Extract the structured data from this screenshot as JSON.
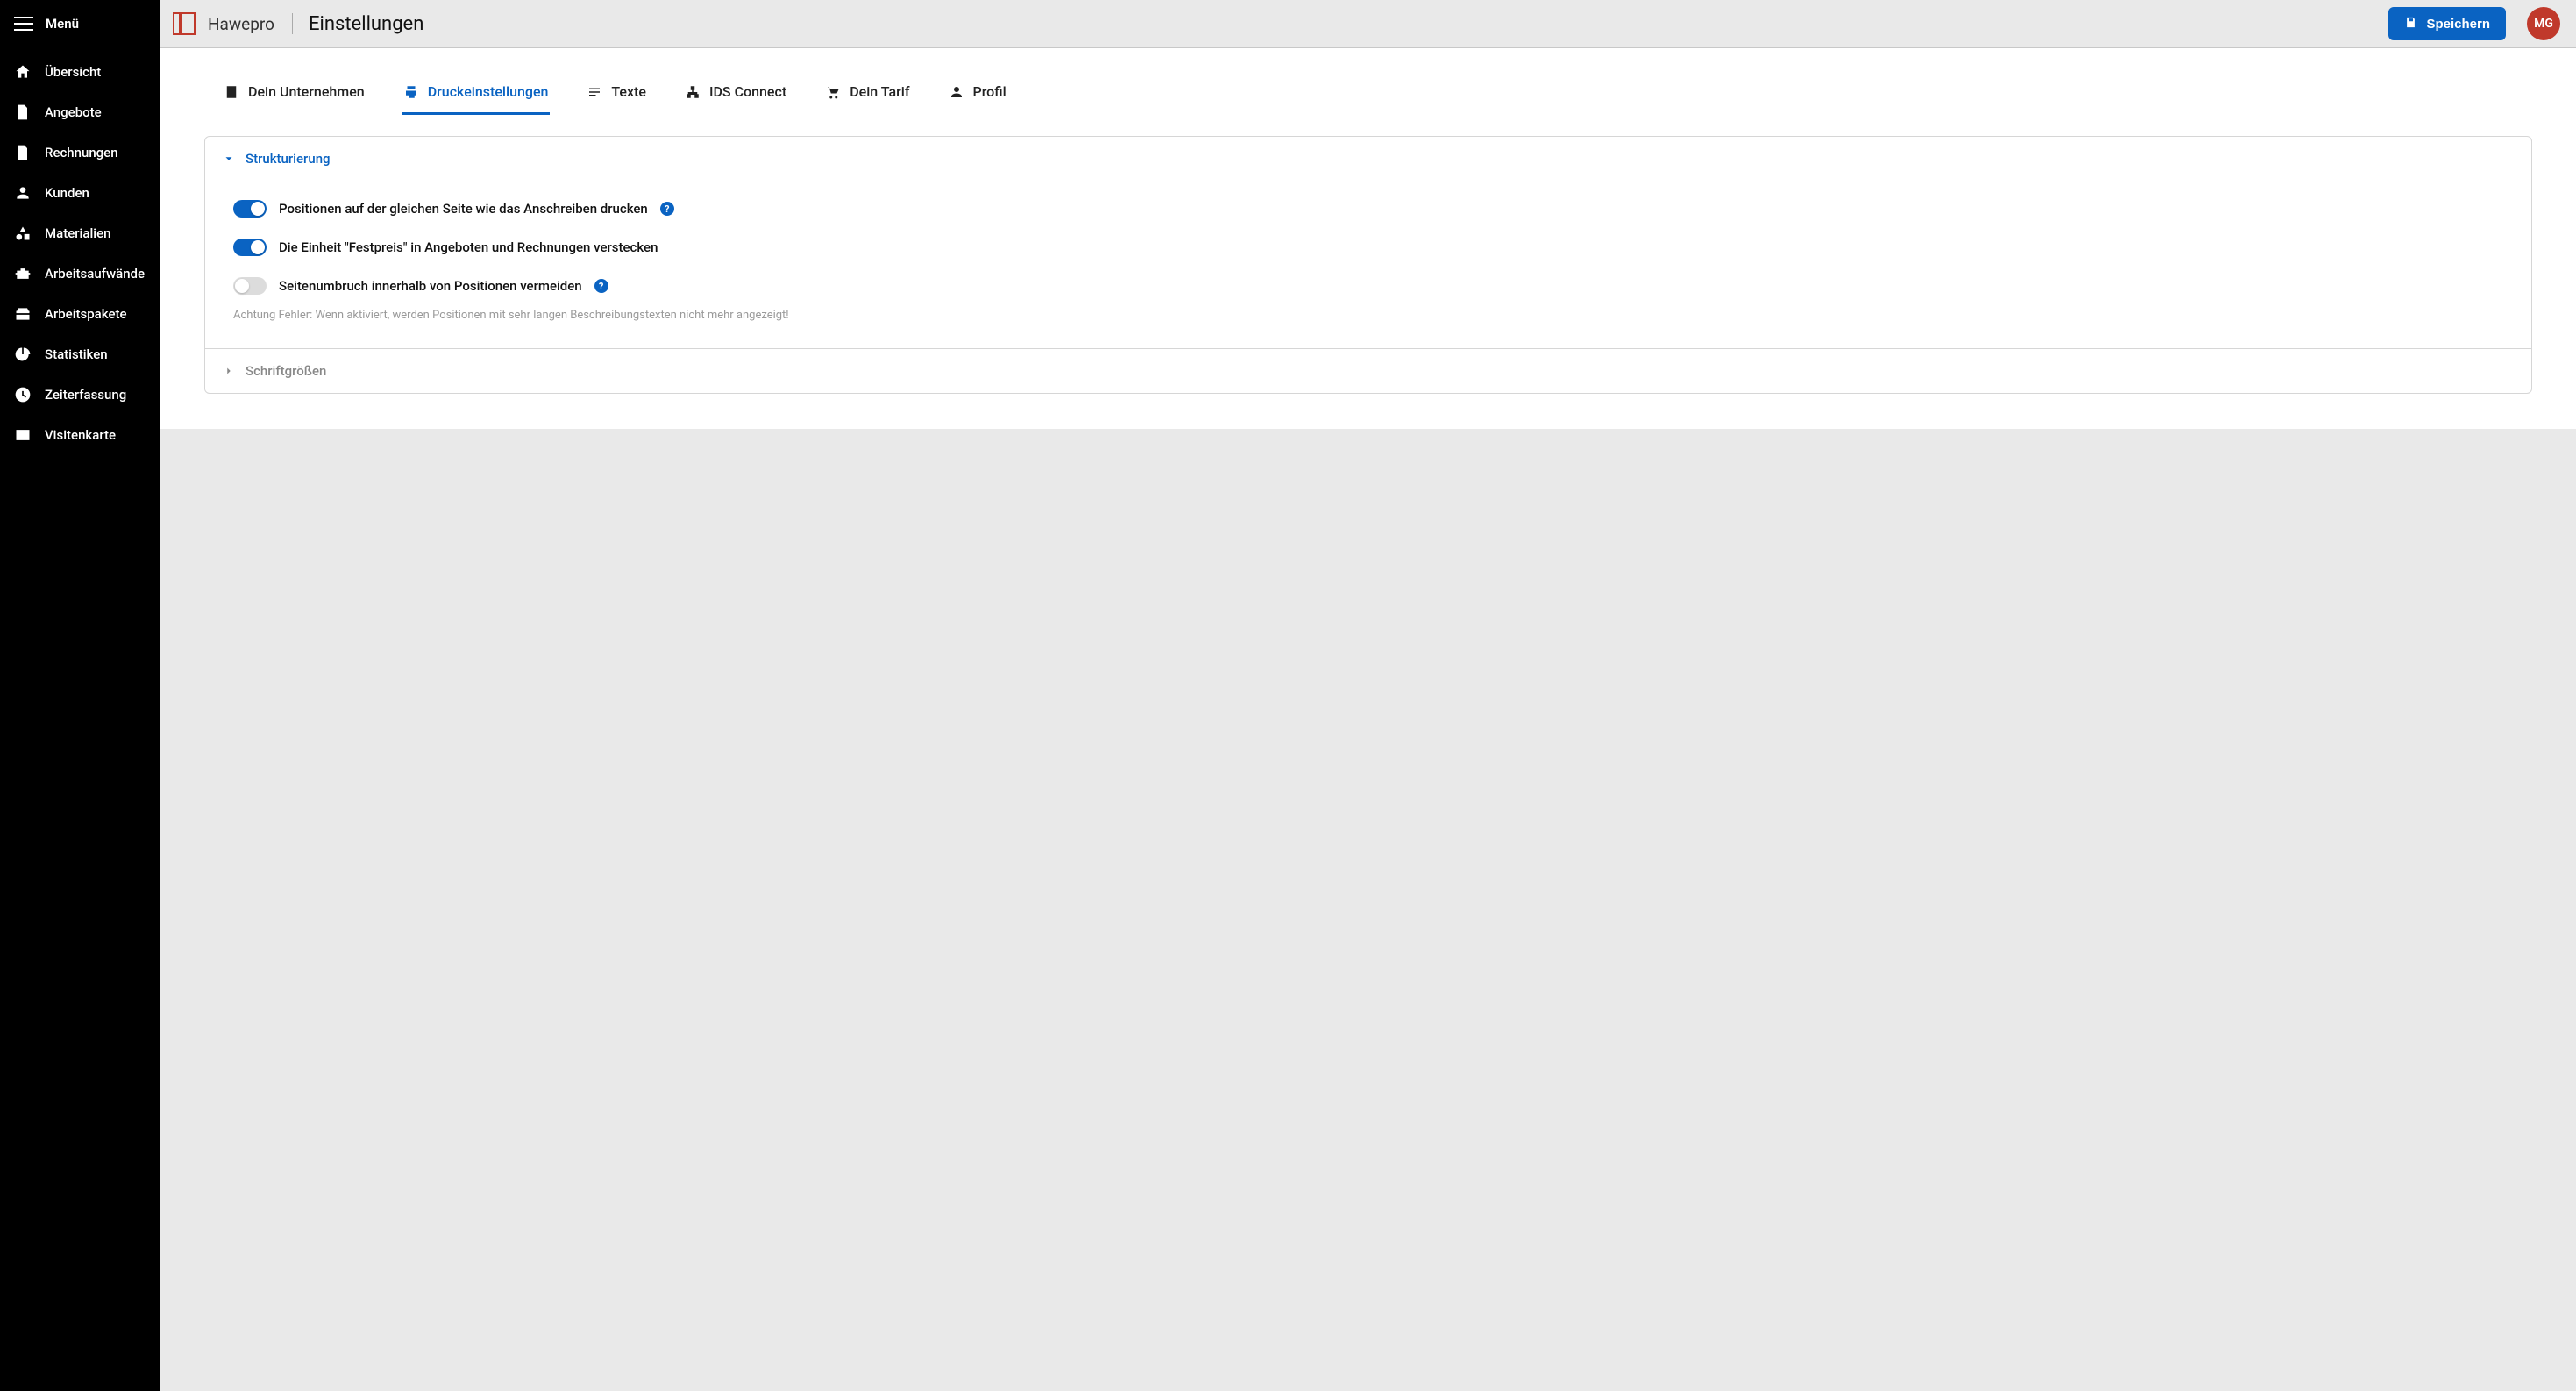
{
  "sidebar": {
    "menu_label": "Menü",
    "items": [
      {
        "label": "Übersicht"
      },
      {
        "label": "Angebote"
      },
      {
        "label": "Rechnungen"
      },
      {
        "label": "Kunden"
      },
      {
        "label": "Materialien"
      },
      {
        "label": "Arbeitsaufwände"
      },
      {
        "label": "Arbeitspakete"
      },
      {
        "label": "Statistiken"
      },
      {
        "label": "Zeiterfassung"
      },
      {
        "label": "Visitenkarte"
      }
    ]
  },
  "header": {
    "brand": "Hawepro",
    "page_title": "Einstellungen",
    "save_label": "Speichern",
    "avatar_initials": "MG"
  },
  "tabs": [
    {
      "label": "Dein Unternehmen",
      "active": false
    },
    {
      "label": "Druckeinstellungen",
      "active": true
    },
    {
      "label": "Texte",
      "active": false
    },
    {
      "label": "IDS Connect",
      "active": false
    },
    {
      "label": "Dein Tarif",
      "active": false
    },
    {
      "label": "Profil",
      "active": false
    }
  ],
  "panels": {
    "strukturierung": {
      "title": "Strukturierung",
      "settings": [
        {
          "label": "Positionen auf der gleichen Seite wie das Anschreiben drucken",
          "on": true,
          "help": true
        },
        {
          "label": "Die Einheit \"Festpreis\" in Angeboten und Rechnungen verstecken",
          "on": true,
          "help": false
        },
        {
          "label": "Seitenumbruch innerhalb von Positionen vermeiden",
          "on": false,
          "help": true
        }
      ],
      "note": "Achtung Fehler: Wenn aktiviert, werden Positionen mit sehr langen Beschreibungstexten nicht mehr angezeigt!"
    },
    "schriftgroessen": {
      "title": "Schriftgrößen"
    }
  },
  "colors": {
    "primary": "#0a63c2",
    "accent": "#c0392b"
  }
}
